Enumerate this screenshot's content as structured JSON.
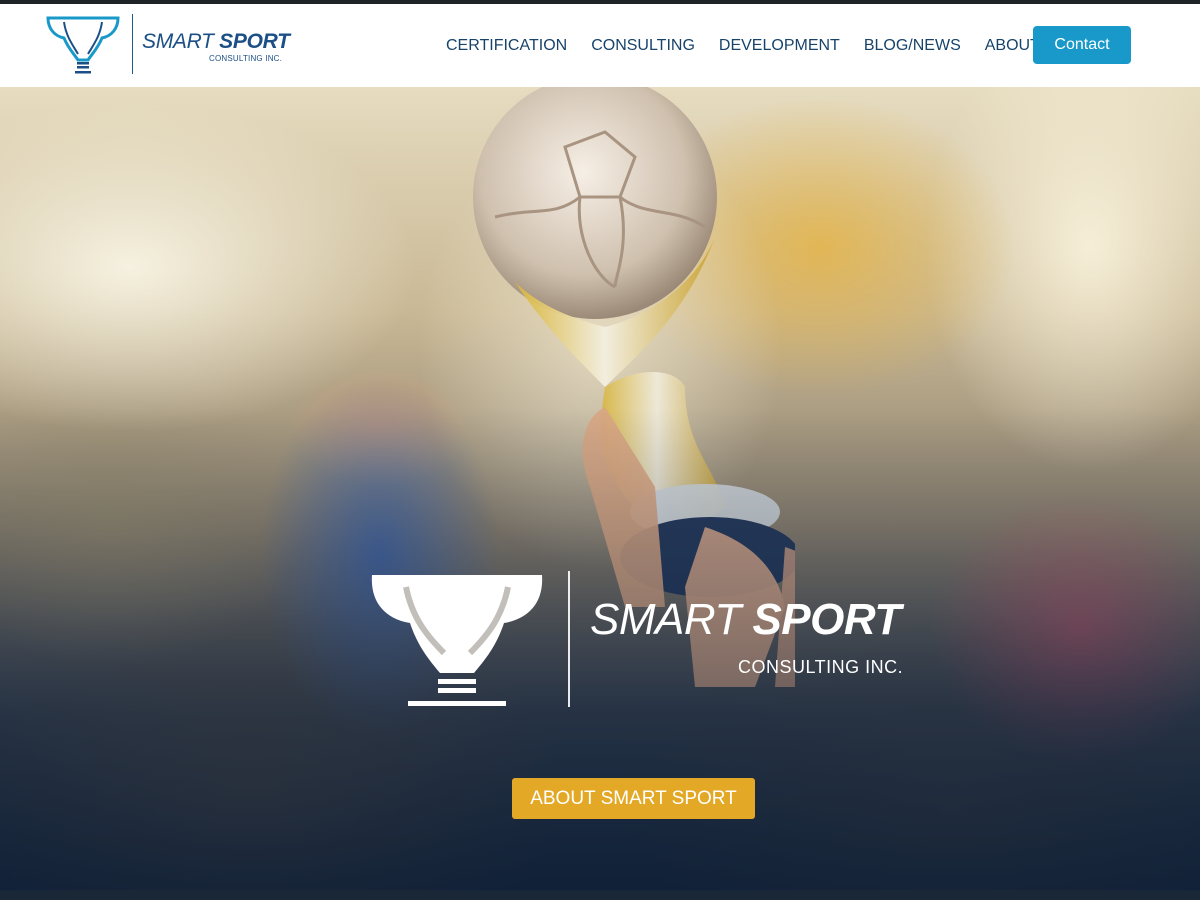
{
  "brand": {
    "name_light": "SMART",
    "name_bold": "SPORT",
    "subtitle": "CONSULTING INC.",
    "primary_color": "#1b4f86",
    "logo_icon": "trophy-lightbulb-icon"
  },
  "nav": {
    "items": [
      {
        "label": "CERTIFICATION"
      },
      {
        "label": "CONSULTING"
      },
      {
        "label": "DEVELOPMENT"
      },
      {
        "label": "BLOG/NEWS"
      },
      {
        "label": "ABOUT"
      }
    ],
    "contact_label": "Contact",
    "contact_color": "#1899c9"
  },
  "hero": {
    "logo_name_light": "SMART",
    "logo_name_bold": "SPORT",
    "logo_subtitle": "CONSULTING INC.",
    "button_label": "ABOUT SMART SPORT",
    "button_color": "#e3a825",
    "image": "soccer-trophy-raised-by-hands"
  }
}
